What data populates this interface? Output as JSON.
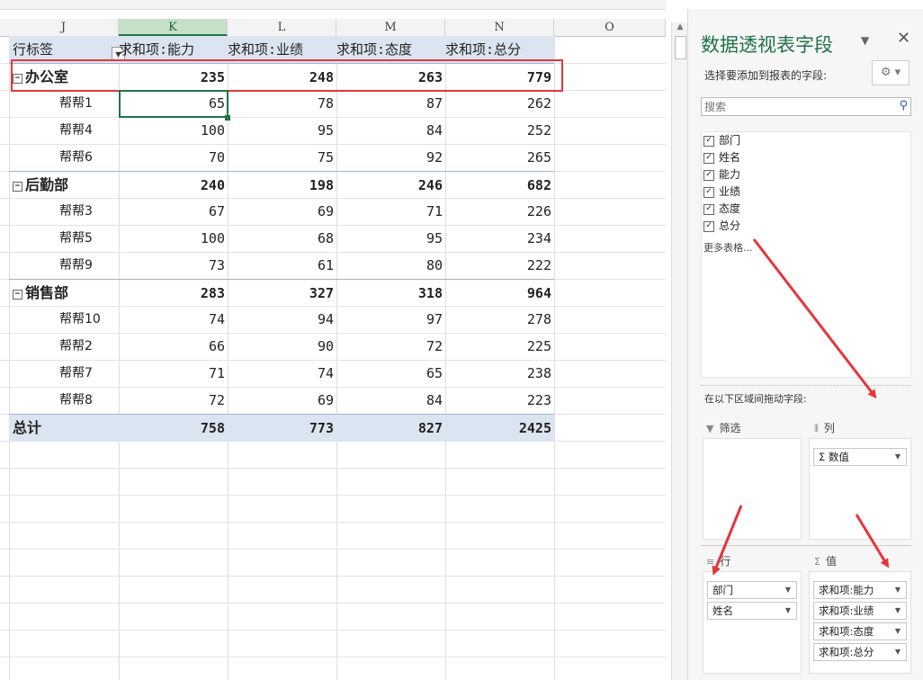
{
  "columns": [
    "J",
    "K",
    "L",
    "M",
    "N",
    "O"
  ],
  "pivot": {
    "header": {
      "row_label": "行标签",
      "values": [
        "求和项:能力",
        "求和项:业绩",
        "求和项:态度",
        "求和项:总分"
      ]
    },
    "rows": [
      {
        "type": "group",
        "label": "办公室",
        "values": [
          "235",
          "248",
          "263",
          "779"
        ]
      },
      {
        "type": "item",
        "label": "帮帮1",
        "values": [
          "65",
          "78",
          "87",
          "262"
        ]
      },
      {
        "type": "item",
        "label": "帮帮4",
        "values": [
          "100",
          "95",
          "84",
          "252"
        ]
      },
      {
        "type": "item",
        "label": "帮帮6",
        "values": [
          "70",
          "75",
          "92",
          "265"
        ]
      },
      {
        "type": "group",
        "label": "后勤部",
        "values": [
          "240",
          "198",
          "246",
          "682"
        ]
      },
      {
        "type": "item",
        "label": "帮帮3",
        "values": [
          "67",
          "69",
          "71",
          "226"
        ]
      },
      {
        "type": "item",
        "label": "帮帮5",
        "values": [
          "100",
          "68",
          "95",
          "234"
        ]
      },
      {
        "type": "item",
        "label": "帮帮9",
        "values": [
          "73",
          "61",
          "80",
          "222"
        ]
      },
      {
        "type": "group",
        "label": "销售部",
        "values": [
          "283",
          "327",
          "318",
          "964"
        ]
      },
      {
        "type": "item",
        "label": "帮帮10",
        "values": [
          "74",
          "94",
          "97",
          "278"
        ]
      },
      {
        "type": "item",
        "label": "帮帮2",
        "values": [
          "66",
          "90",
          "72",
          "225"
        ]
      },
      {
        "type": "item",
        "label": "帮帮7",
        "values": [
          "71",
          "74",
          "65",
          "238"
        ]
      },
      {
        "type": "item",
        "label": "帮帮8",
        "values": [
          "72",
          "69",
          "84",
          "223"
        ]
      }
    ],
    "grand_total": {
      "label": "总计",
      "values": [
        "758",
        "773",
        "827",
        "2425"
      ]
    },
    "collapse_glyph": "⊟"
  },
  "pane": {
    "title": "数据透视表字段",
    "subtitle": "选择要添加到报表的字段:",
    "search_placeholder": "搜索",
    "fields": [
      {
        "label": "部门",
        "checked": true
      },
      {
        "label": "姓名",
        "checked": true
      },
      {
        "label": "能力",
        "checked": true
      },
      {
        "label": "业绩",
        "checked": true
      },
      {
        "label": "态度",
        "checked": true
      },
      {
        "label": "总分",
        "checked": true
      }
    ],
    "more_tables": "更多表格...",
    "drag_tip": "在以下区域间拖动字段:",
    "areas": {
      "filter": {
        "label": "筛选",
        "items": []
      },
      "columns": {
        "label": "列",
        "items": [
          "Σ 数值"
        ]
      },
      "rows": {
        "label": "行",
        "items": [
          "部门",
          "姓名"
        ]
      },
      "values": {
        "label": "值",
        "items": [
          "求和项:能力",
          "求和项:业绩",
          "求和项:态度",
          "求和项:总分"
        ]
      }
    }
  },
  "colors": {
    "accent": "#217346",
    "highlight_box": "#e0393e",
    "pivot_header_bg": "#dbe5f1",
    "arrow": "#e8343a"
  }
}
